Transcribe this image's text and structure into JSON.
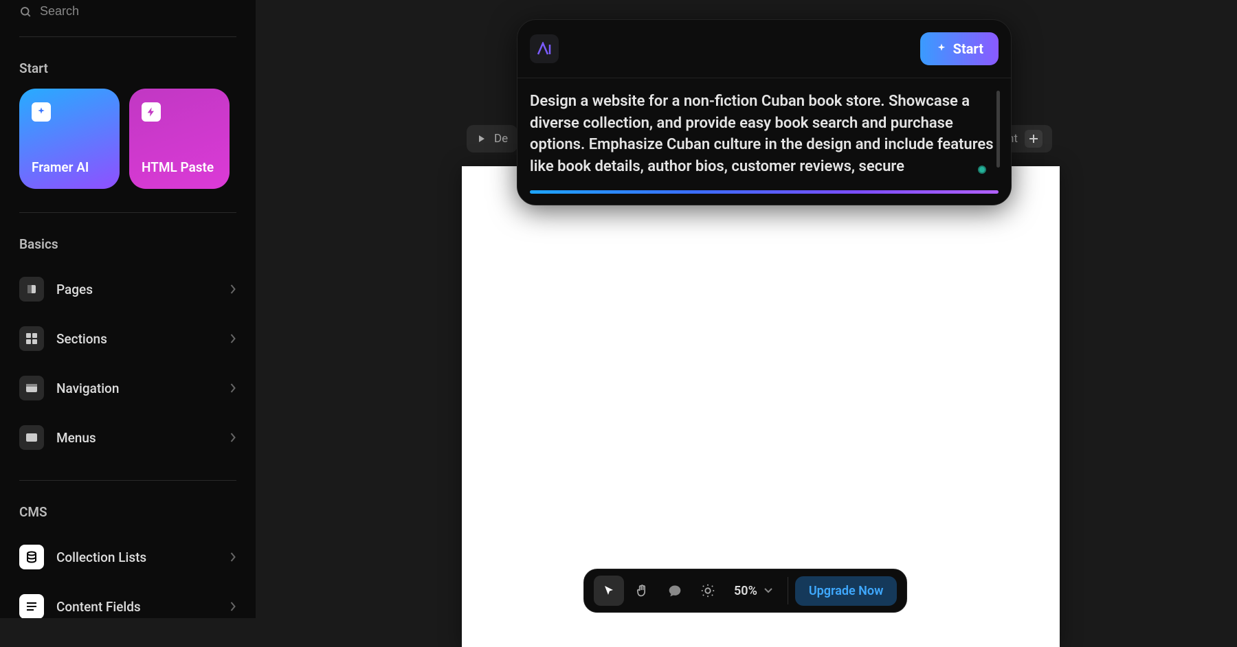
{
  "search": {
    "placeholder": "Search"
  },
  "sidebar": {
    "start_heading": "Start",
    "tile_ai": "Framer AI",
    "tile_html": "HTML Paste",
    "basics_heading": "Basics",
    "basics": [
      {
        "label": "Pages"
      },
      {
        "label": "Sections"
      },
      {
        "label": "Navigation"
      },
      {
        "label": "Menus"
      }
    ],
    "cms_heading": "CMS",
    "cms": [
      {
        "label": "Collection Lists"
      },
      {
        "label": "Content Fields"
      }
    ]
  },
  "behind": {
    "left_prefix": "De",
    "right_suffix": "nt"
  },
  "ai": {
    "start_label": "Start",
    "prompt": "Design a website for a non-fiction Cuban book store. Showcase a diverse collection, and provide easy book search and purchase options. Emphasize Cuban culture in the design and include features like book details, author bios, customer reviews, secure"
  },
  "toolbar": {
    "zoom_value": "50%",
    "upgrade_label": "Upgrade Now"
  }
}
